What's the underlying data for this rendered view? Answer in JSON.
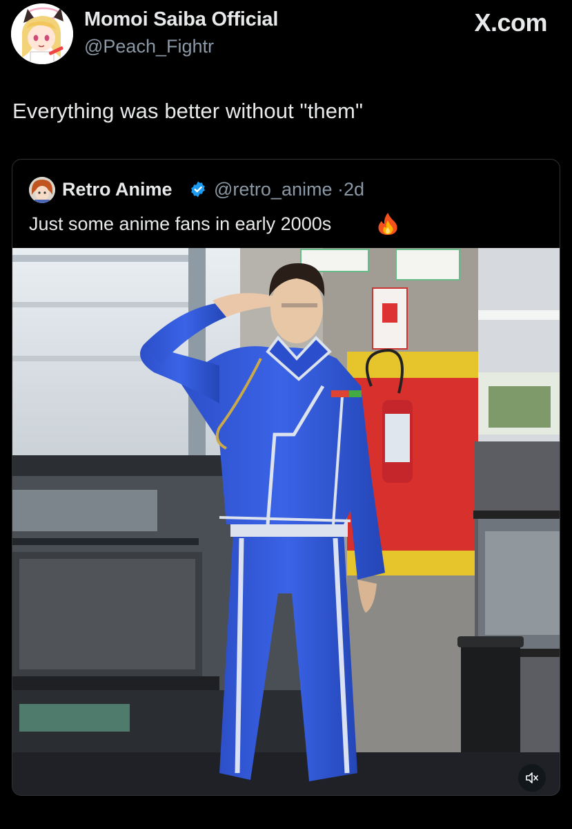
{
  "post": {
    "author_name": "Momoi Saiba Official",
    "author_handle": "@Peach_Fightr",
    "brand": "X.com",
    "text": "Everything was better without \"them\""
  },
  "quoted": {
    "author_name": "Retro Anime",
    "author_handle": "@retro_anime",
    "separator": "·",
    "age": "2d",
    "text": "Just some anime fans in early 2000s",
    "emoji_icon": "fire-icon",
    "verified_icon": "verified-badge-icon"
  },
  "media": {
    "type": "video",
    "control_icon": "speaker-muted-icon"
  },
  "colors": {
    "background": "#000000",
    "primary_text": "#e7e9ea",
    "secondary_text": "#8b98a5",
    "border": "#2f3336",
    "verified_blue": "#1d9bf0"
  }
}
